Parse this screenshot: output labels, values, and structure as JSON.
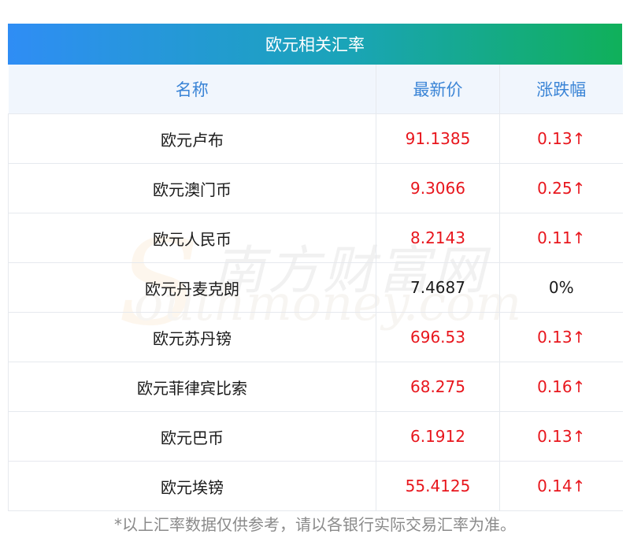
{
  "table": {
    "title": "欧元相关汇率",
    "headers": {
      "name": "名称",
      "price": "最新价",
      "change": "涨跌幅"
    },
    "rows": [
      {
        "name": "欧元卢布",
        "price": "91.1385",
        "change": "0.13↑",
        "trend": "up"
      },
      {
        "name": "欧元澳门币",
        "price": "9.3066",
        "change": "0.25↑",
        "trend": "up"
      },
      {
        "name": "欧元人民币",
        "price": "8.2143",
        "change": "0.11↑",
        "trend": "up"
      },
      {
        "name": "欧元丹麦克朗",
        "price": "7.4687",
        "change": "0%",
        "trend": "flat"
      },
      {
        "name": "欧元苏丹镑",
        "price": "696.53",
        "change": "0.13↑",
        "trend": "up"
      },
      {
        "name": "欧元菲律宾比索",
        "price": "68.275",
        "change": "0.16↑",
        "trend": "up"
      },
      {
        "name": "欧元巴币",
        "price": "6.1912",
        "change": "0.13↑",
        "trend": "up"
      },
      {
        "name": "欧元埃镑",
        "price": "55.4125",
        "change": "0.14↑",
        "trend": "up"
      }
    ]
  },
  "watermark": {
    "cn": "南方财富网",
    "en": "Southmoney.com"
  },
  "footnote": "*以上汇率数据仅供参考，请以各银行实际交易汇率为准。",
  "colors": {
    "up": "#e8161d",
    "flat": "#1a1a1a",
    "header_text": "#3a84d6",
    "header_bg": "#f1f6fd",
    "title_gradient_start": "#2f8df5",
    "title_gradient_end": "#10b05a"
  }
}
